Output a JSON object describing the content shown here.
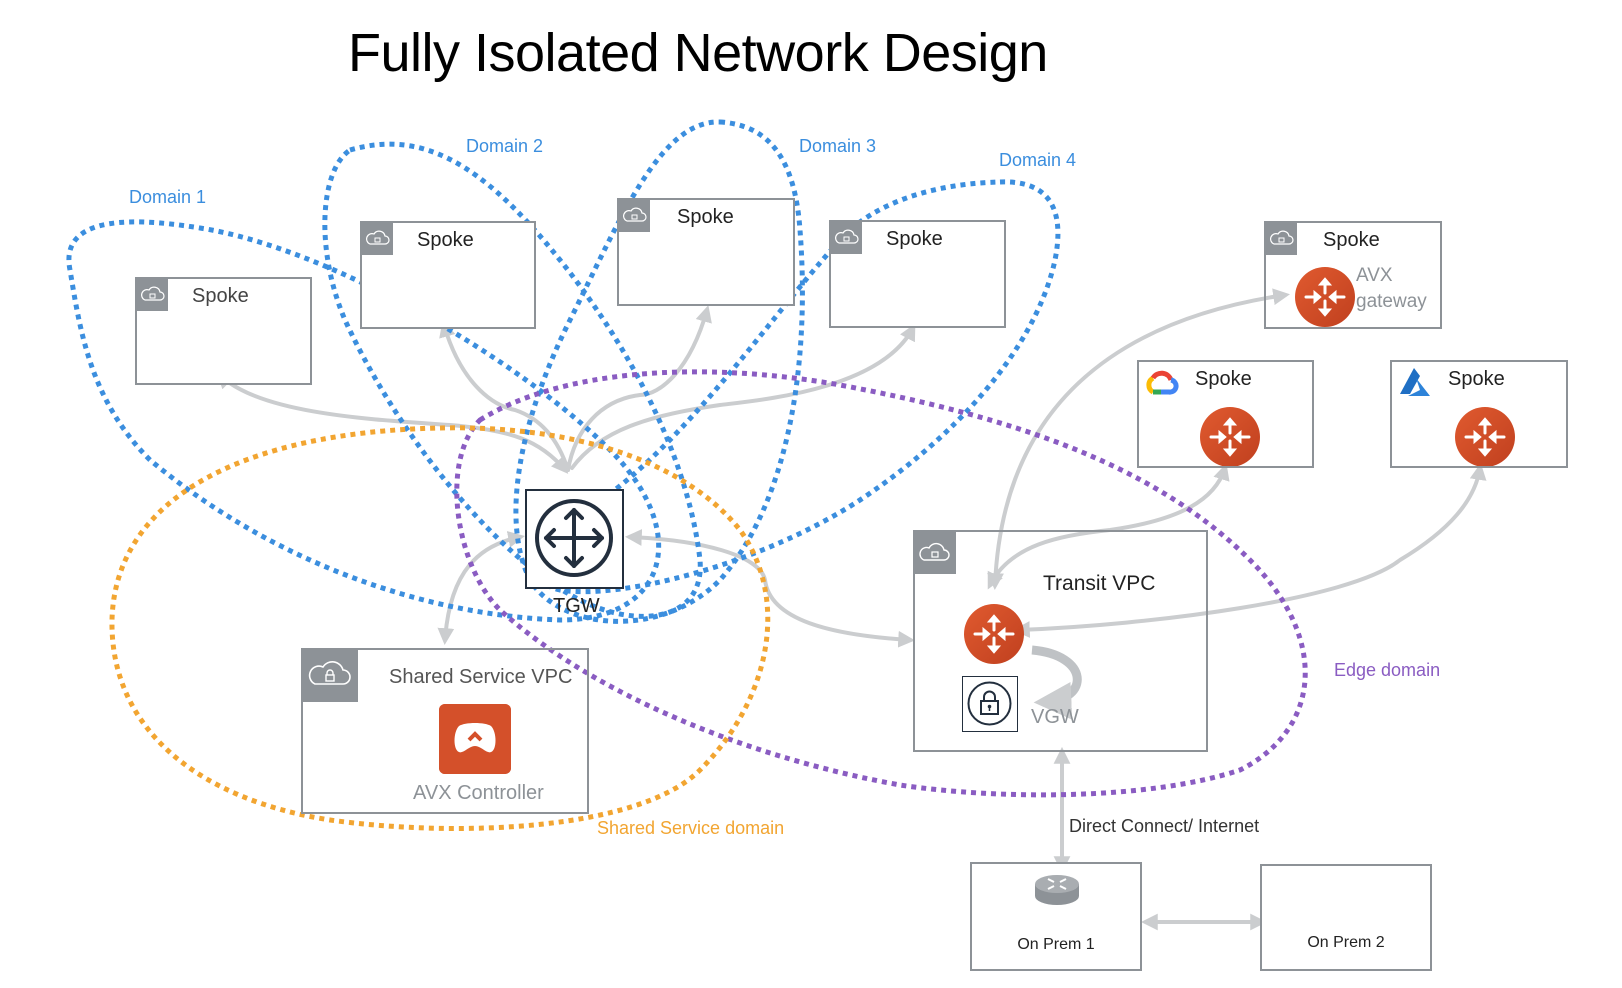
{
  "title": "Fully Isolated Network Design",
  "colors": {
    "domain_blue": "#3b8ede",
    "edge_purple": "#8a5cc2",
    "shared_orange": "#f2a531",
    "connector_gray": "#cbcdcf",
    "box_border": "#8d9297",
    "gateway_orange": "#d4502a"
  },
  "domains": [
    {
      "id": "domain-1",
      "label": "Domain 1"
    },
    {
      "id": "domain-2",
      "label": "Domain 2"
    },
    {
      "id": "domain-3",
      "label": "Domain 3"
    },
    {
      "id": "domain-4",
      "label": "Domain 4"
    },
    {
      "id": "edge-domain",
      "label": "Edge domain"
    },
    {
      "id": "shared-service-domain",
      "label": "Shared Service domain"
    }
  ],
  "nodes": {
    "spoke1": {
      "title": "Spoke",
      "icon": "aws-vpc-cloud-lock-icon"
    },
    "spoke2": {
      "title": "Spoke",
      "icon": "aws-vpc-cloud-lock-icon"
    },
    "spoke3": {
      "title": "Spoke",
      "icon": "aws-vpc-cloud-lock-icon"
    },
    "spoke4": {
      "title": "Spoke",
      "icon": "aws-vpc-cloud-lock-icon"
    },
    "spoke_avx": {
      "title": "Spoke",
      "icon": "aws-vpc-cloud-lock-icon",
      "gateway_label_line1": "AVX",
      "gateway_label_line2": "gateway"
    },
    "spoke_gcp": {
      "title": "Spoke",
      "icon": "google-cloud-icon"
    },
    "spoke_azure": {
      "title": "Spoke",
      "icon": "azure-icon"
    },
    "tgw": {
      "label": "TGW",
      "icon": "transit-gateway-icon"
    },
    "shared_service_vpc": {
      "title": "Shared Service VPC",
      "sub": "AVX Controller",
      "icon": "avx-controller-icon"
    },
    "transit_vpc": {
      "title": "Transit VPC",
      "vgw_label": "VGW"
    },
    "onprem1": {
      "title": "On Prem 1",
      "icon": "router-icon"
    },
    "onprem2": {
      "title": "On Prem 2"
    }
  },
  "connections": {
    "direct_connect_label": "Direct Connect/ Internet"
  }
}
